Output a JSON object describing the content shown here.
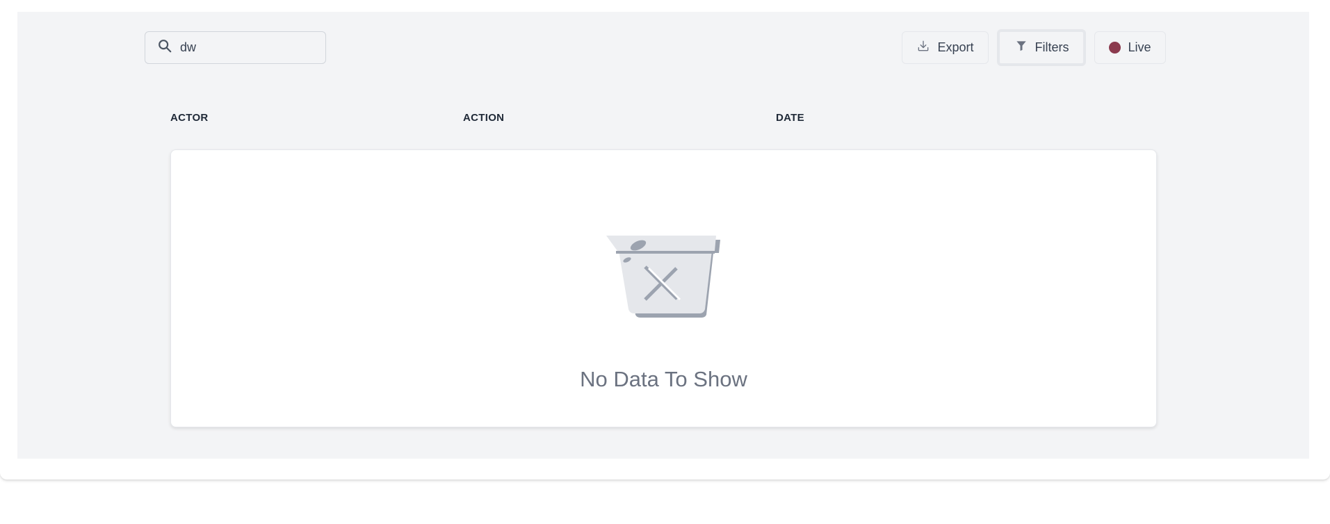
{
  "search": {
    "value": "dw",
    "icon": "search-icon"
  },
  "toolbar": {
    "export_label": "Export",
    "export_icon": "download-icon",
    "filters_label": "Filters",
    "filters_icon": "filter-icon",
    "live_label": "Live",
    "live_dot_color": "#8b3a4e"
  },
  "table": {
    "columns": [
      "ACTOR",
      "ACTION",
      "DATE"
    ]
  },
  "empty_state": {
    "icon": "empty-bin-icon",
    "message": "No Data To Show"
  }
}
